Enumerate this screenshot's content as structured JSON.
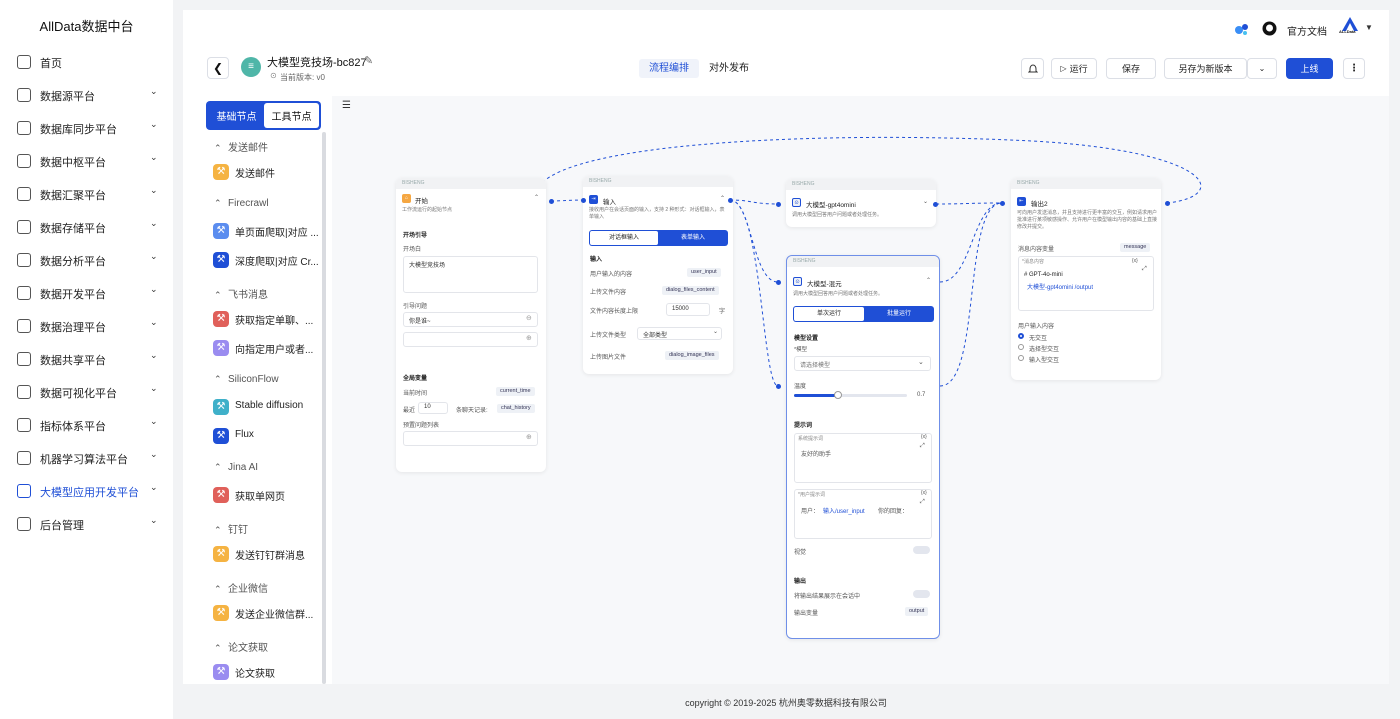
{
  "brand": "AllData数据中台",
  "menu": [
    {
      "label": "首页",
      "has_children": false
    },
    {
      "label": "数据源平台",
      "has_children": true
    },
    {
      "label": "数据库同步平台",
      "has_children": true
    },
    {
      "label": "数据中枢平台",
      "has_children": true
    },
    {
      "label": "数据汇聚平台",
      "has_children": true
    },
    {
      "label": "数据存储平台",
      "has_children": true
    },
    {
      "label": "数据分析平台",
      "has_children": true
    },
    {
      "label": "数据开发平台",
      "has_children": true
    },
    {
      "label": "数据治理平台",
      "has_children": true
    },
    {
      "label": "数据共享平台",
      "has_children": true
    },
    {
      "label": "数据可视化平台",
      "has_children": true
    },
    {
      "label": "指标体系平台",
      "has_children": true
    },
    {
      "label": "机器学习算法平台",
      "has_children": true
    },
    {
      "label": "大模型应用开发平台",
      "has_children": true,
      "active": true
    },
    {
      "label": "后台管理",
      "has_children": true
    }
  ],
  "topbar": {
    "docs": "官方文档",
    "user_logo_text": "ALLData"
  },
  "flow": {
    "title": "大模型竞技场-bc827",
    "version": "当前版本: v0",
    "tabs": [
      "流程编排",
      "对外发布"
    ],
    "actions": {
      "run": "运行",
      "save": "保存",
      "save_as": "另存为新版本",
      "publish": "上线"
    }
  },
  "panel": {
    "segments": [
      "基础节点",
      "工具节点"
    ],
    "categories": [
      {
        "name": "发送邮件",
        "tools": [
          {
            "label": "发送邮件",
            "color": "#f5b342"
          }
        ]
      },
      {
        "name": "Firecrawl",
        "tools": [
          {
            "label": "单页面爬取|对应 ...",
            "color": "#5b8def"
          },
          {
            "label": "深度爬取|对应 Cr...",
            "color": "#1f4fd6"
          }
        ]
      },
      {
        "name": "飞书消息",
        "tools": [
          {
            "label": "获取指定单聊、...",
            "color": "#e0605a"
          },
          {
            "label": "向指定用户或者...",
            "color": "#9a8cf0"
          }
        ]
      },
      {
        "name": "SiliconFlow",
        "tools": [
          {
            "label": "Stable diffusion",
            "color": "#3fb0c9"
          },
          {
            "label": "Flux",
            "color": "#1f4fd6"
          }
        ]
      },
      {
        "name": "Jina AI",
        "tools": [
          {
            "label": "获取单网页",
            "color": "#e0605a"
          }
        ]
      },
      {
        "name": "钉钉",
        "tools": [
          {
            "label": "发送钉钉群消息",
            "color": "#f5b342"
          }
        ]
      },
      {
        "name": "企业微信",
        "tools": [
          {
            "label": "发送企业微信群...",
            "color": "#f5b342"
          }
        ]
      },
      {
        "name": "论文获取",
        "tools": [
          {
            "label": "论文获取",
            "color": "#9a8cf0"
          }
        ]
      }
    ]
  },
  "nodes": {
    "header_tag": "BISHENG",
    "start": {
      "title": "开始",
      "desc": "工作流运行的起始节点",
      "guide_section": "开场引导",
      "opening_label": "开场白",
      "opening_value": "大模型竞技场",
      "question_label": "引导问题",
      "question_value": "你是谁~",
      "globals_section": "全局变量",
      "current_time_label": "当前时间",
      "current_time_tag": "current_time",
      "recent_label": "最近",
      "recent_value": "10",
      "history_label": "条聊天记录:",
      "history_tag": "chat_history",
      "preset_label": "预置问题列表"
    },
    "input": {
      "title": "输入",
      "desc": "接收用户在会话页面的输入，支持 2 种形式：对话框输入，表单输入",
      "tab_dialog": "对话框输入",
      "tab_form": "表单输入",
      "section": "输入",
      "rows": [
        {
          "label": "用户输入的内容",
          "tag": "user_input"
        },
        {
          "label": "上传文件内容",
          "tag": "dialog_files_content"
        }
      ],
      "limit_label": "文件内容长度上限",
      "limit_value": "15000",
      "limit_unit": "字",
      "type_label": "上传文件类型",
      "type_value": "全部类型",
      "image_label": "上传图片文件",
      "image_tag": "dialog_image_files"
    },
    "llm1": {
      "title": "大模型-gpt4omini",
      "desc": "调用大模型回答用户问题或者处理任务。"
    },
    "llm2": {
      "title": "大模型-混元",
      "desc": "调用大模型回答用户问题或者处理任务。",
      "tab_single": "单次运行",
      "tab_batch": "批量运行",
      "model_section": "模型设置",
      "model_label": "*模型",
      "model_placeholder": "请选择模型",
      "temp_label": "温度",
      "temp_value": "0.7",
      "temp_fraction": 0.7,
      "prompt_section": "提示词",
      "sys_label": "系统提示词",
      "sys_value": "友好的助手",
      "user_label": "*用户提示词",
      "user_prefix": "用户：",
      "user_var": "输入/user_input",
      "user_suffix": "你的回复：",
      "vision_label": "视觉",
      "output_section": "输出",
      "output_show_label": "将输出结果展示在会话中",
      "output_var_label": "输出变量",
      "output_var_tag": "output"
    },
    "output": {
      "title": "输出2",
      "desc": "可向用户发送消息，并且支持进行更丰富的交互，例如请求用户批准进行某项敏感操作、允许用户在模型输出内容的基础上直接修改并提交。",
      "msg_label": "消息内容变量",
      "msg_tag": "message",
      "msg_content_label": "*消息内容",
      "msg_line1": "# GPT-4o-mini",
      "msg_line2": "大模型-gpt4omini /output",
      "interaction_label": "用户输入内容",
      "options": [
        "无交互",
        "选择型交互",
        "输入型交互"
      ]
    }
  },
  "footer": "copyright © 2019-2025 杭州奥零数据科技有限公司"
}
